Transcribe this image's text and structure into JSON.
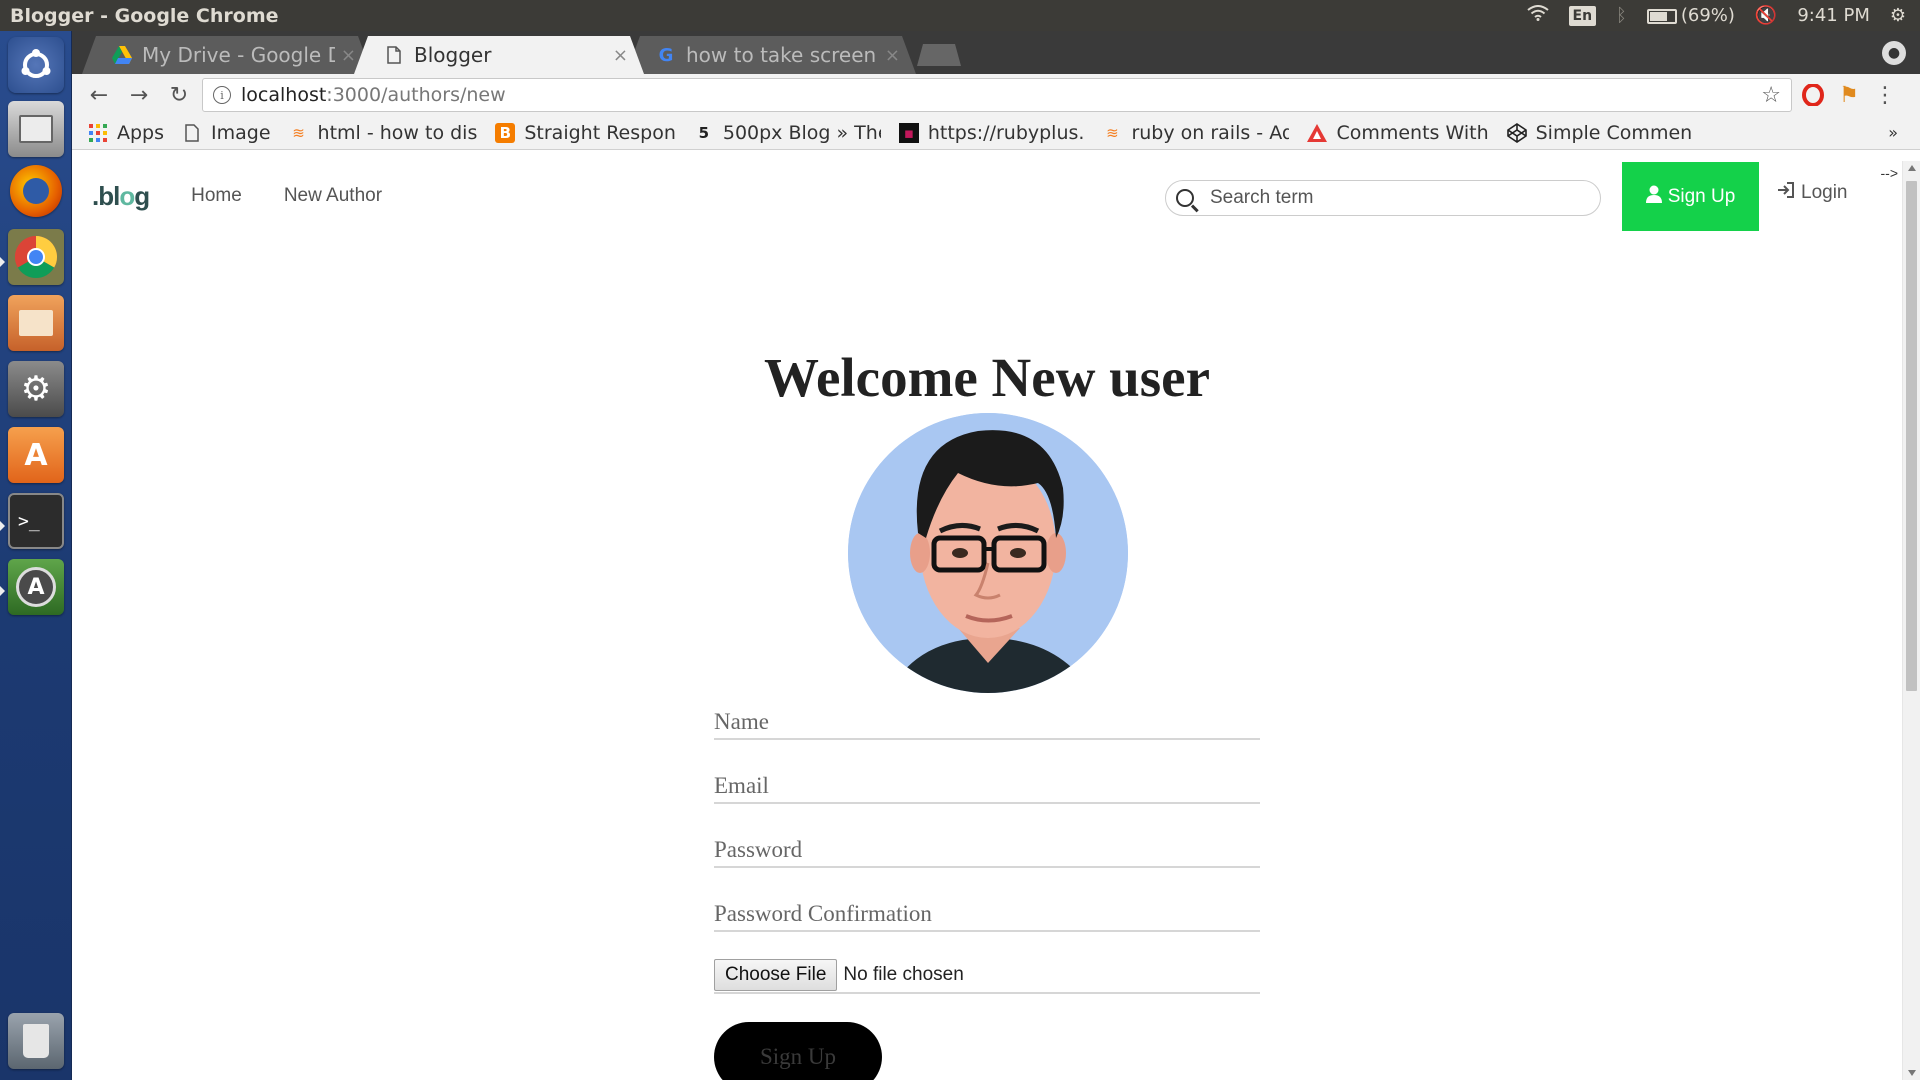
{
  "os": {
    "window_title": "Blogger - Google Chrome",
    "keyboard_layout": "En",
    "battery": "(69%)",
    "clock": "9:41 PM",
    "launcher": [
      "ubuntu-dash-icon",
      "files-icon",
      "firefox-icon",
      "chrome-icon",
      "file-manager-icon",
      "system-settings-icon",
      "software-center-icon",
      "terminal-icon",
      "software-updater-icon",
      "trash-icon"
    ]
  },
  "browser": {
    "tabs": [
      {
        "title": "My Drive - Google D",
        "icon": "google-drive-icon",
        "active": false
      },
      {
        "title": "Blogger",
        "icon": "page-icon",
        "active": true
      },
      {
        "title": "how to take screen",
        "icon": "google-icon",
        "active": false
      }
    ],
    "tab_close": "×",
    "url_host": "localhost",
    "url_path": ":3000/authors/new",
    "bookmarks": [
      {
        "label": "Apps",
        "icon": "apps-grid-icon"
      },
      {
        "label": "Image",
        "icon": "page-icon"
      },
      {
        "label": "html - how to dis",
        "icon": "stackoverflow-icon"
      },
      {
        "label": "Straight Respon",
        "icon": "blogger-icon"
      },
      {
        "label": "500px Blog » The",
        "icon": "500px-icon"
      },
      {
        "label": "https://rubyplus.",
        "icon": "rubyplus-icon"
      },
      {
        "label": "ruby on rails - Ad",
        "icon": "stackoverflow-icon"
      },
      {
        "label": "Comments With",
        "icon": "triangle-icon"
      },
      {
        "label": "Simple Commen",
        "icon": "codepen-icon"
      }
    ],
    "bookmarks_more": "»"
  },
  "page": {
    "logo": {
      "pre": ".bl",
      "o": "o",
      "post": "g"
    },
    "nav": {
      "home": "Home",
      "new_author": "New Author"
    },
    "search_placeholder": "Search term",
    "signup": "Sign Up",
    "login": "Login",
    "comment_leak": "-->",
    "welcome": "Welcome New user",
    "form": {
      "name_placeholder": "Name",
      "email_placeholder": "Email",
      "password_placeholder": "Password",
      "password_confirmation_placeholder": "Password Confirmation",
      "file_button": "Choose File",
      "file_status": "No file chosen",
      "submit": "Sign Up"
    }
  },
  "colors": {
    "signup_green": "#14d14a",
    "avatar_bg": "#a9c7f2",
    "launcher_blue": "#294c8e"
  }
}
